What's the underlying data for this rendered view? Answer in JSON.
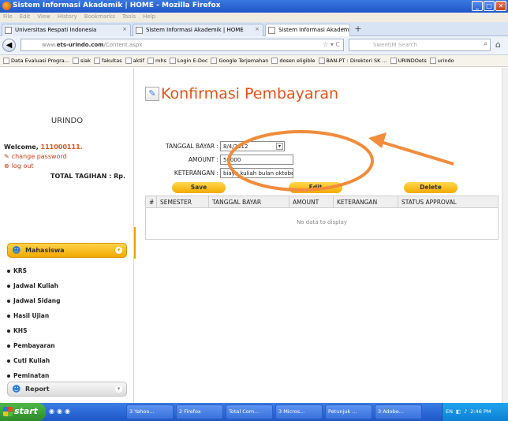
{
  "window": {
    "title": "Sistem Informasi Akademik | HOME - Mozilla Firefox"
  },
  "menubar": [
    "File",
    "Edit",
    "View",
    "History",
    "Bookmarks",
    "Tools",
    "Help"
  ],
  "tabs": [
    {
      "label": "Universitas Respati Indonesia"
    },
    {
      "label": "Sistem Informasi Akademik | HOME"
    },
    {
      "label": "Sistem Informasi Akademik | HOME"
    }
  ],
  "tab_close": "×",
  "new_tab": "+",
  "nav": {
    "url_prefix": "www.",
    "url_host": "ets-urindo.com",
    "url_path": "/Content.aspx",
    "search_placeholder": "SweetIM Search"
  },
  "bookmarks": [
    "Data Evaluasi Progra...",
    "siak",
    "fakultas",
    "aktif",
    "mhs",
    "Login E-Doc",
    "Google Terjemahan",
    "dosen eligible",
    "BAN-PT : Direktori SK ...",
    "URINDOets",
    "urindo"
  ],
  "sidebar": {
    "brand": "URINDO",
    "welcome_prefix": "Welcome, ",
    "user_id": "111000111.",
    "change_password": "change password",
    "log_out": "log out",
    "total_tagihan": "TOTAL TAGIHAN : Rp.",
    "menu_mahasiswa": "Mahasiswa",
    "menu_report": "Report",
    "items": [
      "KRS",
      "Jadwal Kuliah",
      "Jadwal Sidang",
      "Hasil Ujian",
      "KHS",
      "Pembayaran",
      "Cuti Kuliah",
      "Peminatan"
    ]
  },
  "main": {
    "title": "Konfirmasi Pembayaran",
    "tanggal_label": "TANGGAL BAYAR :",
    "tanggal_value": "8/4/2012",
    "amount_label": "AMOUNT :",
    "amount_value": "50000",
    "keterangan_label": "KETERANGAN :",
    "keterangan_value": "biaya kuliah bulan oktober",
    "save": "Save",
    "edit": "Edit",
    "delete": "Delete",
    "grid_headers": [
      "#",
      "SEMESTER",
      "TANGGAL BAYAR",
      "AMOUNT",
      "KETERANGAN",
      "STATUS APPROVAL"
    ],
    "no_data": "No data to display"
  },
  "taskbar": {
    "start": "start",
    "tasks": [
      "3 Yahoo...",
      "2 Firefox",
      "Total Com...",
      "3 Micros...",
      "Petunjuk ...",
      "3 Adobe..."
    ],
    "lang": "EN",
    "clock": "2:46 PM"
  },
  "colors": {
    "accent": "#e0521b",
    "button": "#f2a900",
    "annotation": "#f08c3c"
  }
}
